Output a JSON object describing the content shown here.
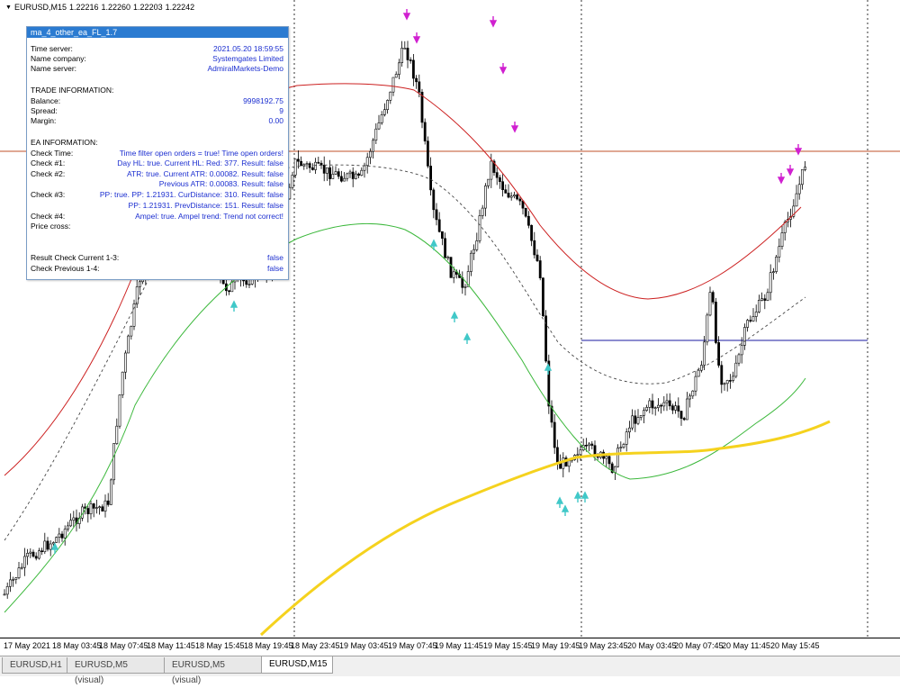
{
  "symbol": {
    "name": "EURUSD,M15",
    "bid_open": "1.22216",
    "high": "1.22260",
    "low": "1.22203",
    "close": "1.22242"
  },
  "panel": {
    "title": "ma_4_other_ea_FL_1.7",
    "time_server_label": "Time server:",
    "time_server_value": "2021.05.20 18:59:55",
    "company_label": "Name company:",
    "company_value": "Systemgates Limited",
    "server_label": "Name server:",
    "server_value": "AdmiralMarkets-Demo",
    "trade_header": "TRADE INFORMATION:",
    "balance_label": "Balance:",
    "balance_value": "9998192.75",
    "spread_label": "Spread:",
    "spread_value": "9",
    "margin_label": "Margin:",
    "margin_value": "0.00",
    "ea_header": "EA INFORMATION:",
    "check_time_label": "Check Time:",
    "check_time_value": "Time filter open orders = true! Time open orders!",
    "check1_label": "Check #1:",
    "check1_value": "Day HL: true. Current HL: Red: 377. Result: false",
    "check2_label": "Check #2:",
    "check2_value": "ATR: true. Current ATR: 0.00082. Result: false",
    "check2b_value": "Previous ATR: 0.00083. Result: false",
    "check3_label": "Check #3:",
    "check3_value": "PP: true. PP: 1.21931. CurDistance: 310. Result: false",
    "check3b_value": "PP: 1.21931. PrevDistance: 151. Result: false",
    "check4_label": "Check #4:",
    "check4_value": "Ampel: true. Ampel trend: Trend not correct!",
    "price_cross_label": "Price cross:",
    "result_current_label": "Result Check Current 1-3:",
    "result_current_value": "false",
    "check_previous_label": "Check Previous 1-4:",
    "check_previous_value": "false"
  },
  "xaxis": [
    "17 May 2021",
    "18 May 03:45",
    "18 May 07:45",
    "18 May 11:45",
    "18 May 15:45",
    "18 May 19:45",
    "18 May 23:45",
    "19 May 03:45",
    "19 May 07:45",
    "19 May 11:45",
    "19 May 15:45",
    "19 May 19:45",
    "19 May 23:45",
    "20 May 03:45",
    "20 May 07:45",
    "20 May 11:45",
    "20 May 15:45"
  ],
  "tabs": [
    "EURUSD,H1",
    "EURUSD,M5 (visual)",
    "EURUSD,M5 (visual)",
    "EURUSD,M15"
  ],
  "colors": {
    "red_ma": "#cc2020",
    "green_ma": "#3cb83c",
    "yellow_ma": "#f5d21e",
    "dashed_ma": "#444444",
    "pivot_line": "#1a1aa0",
    "price_line": "#c0522a",
    "arrow_sell": "#d020d0",
    "arrow_buy": "#40c8c8"
  }
}
